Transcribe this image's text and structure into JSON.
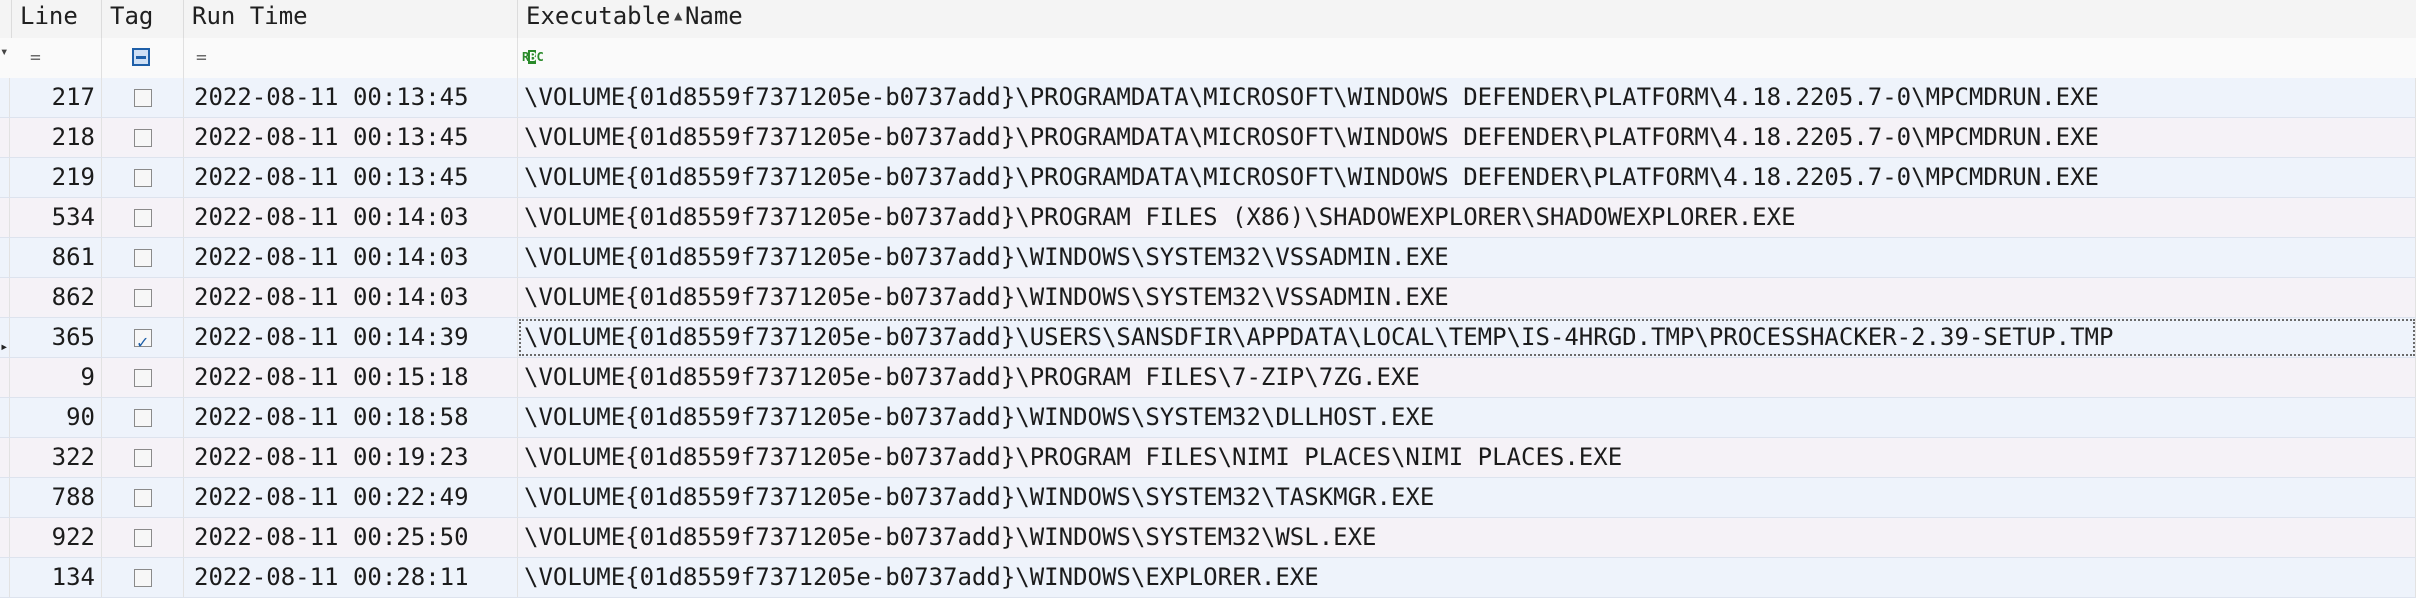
{
  "columns": {
    "line": "Line",
    "tag": "Tag",
    "run_time": "Run Time",
    "exe": "Executable Name"
  },
  "sort": {
    "column": "run_time",
    "direction": "ascending"
  },
  "filters": {
    "line_op": "=",
    "run_time_op": "="
  },
  "rows": [
    {
      "line": "217",
      "tagged": false,
      "run_time": "2022-08-11 00:13:45",
      "exe": "\\VOLUME{01d8559f7371205e-b0737add}\\PROGRAMDATA\\MICROSOFT\\WINDOWS DEFENDER\\PLATFORM\\4.18.2205.7-0\\MPCMDRUN.EXE"
    },
    {
      "line": "218",
      "tagged": false,
      "run_time": "2022-08-11 00:13:45",
      "exe": "\\VOLUME{01d8559f7371205e-b0737add}\\PROGRAMDATA\\MICROSOFT\\WINDOWS DEFENDER\\PLATFORM\\4.18.2205.7-0\\MPCMDRUN.EXE"
    },
    {
      "line": "219",
      "tagged": false,
      "run_time": "2022-08-11 00:13:45",
      "exe": "\\VOLUME{01d8559f7371205e-b0737add}\\PROGRAMDATA\\MICROSOFT\\WINDOWS DEFENDER\\PLATFORM\\4.18.2205.7-0\\MPCMDRUN.EXE"
    },
    {
      "line": "534",
      "tagged": false,
      "run_time": "2022-08-11 00:14:03",
      "exe": "\\VOLUME{01d8559f7371205e-b0737add}\\PROGRAM FILES (X86)\\SHADOWEXPLORER\\SHADOWEXPLORER.EXE"
    },
    {
      "line": "861",
      "tagged": false,
      "run_time": "2022-08-11 00:14:03",
      "exe": "\\VOLUME{01d8559f7371205e-b0737add}\\WINDOWS\\SYSTEM32\\VSSADMIN.EXE"
    },
    {
      "line": "862",
      "tagged": false,
      "run_time": "2022-08-11 00:14:03",
      "exe": "\\VOLUME{01d8559f7371205e-b0737add}\\WINDOWS\\SYSTEM32\\VSSADMIN.EXE"
    },
    {
      "line": "365",
      "tagged": true,
      "selected": true,
      "run_time": "2022-08-11 00:14:39",
      "exe": "\\VOLUME{01d8559f7371205e-b0737add}\\USERS\\SANSDFIR\\APPDATA\\LOCAL\\TEMP\\IS-4HRGD.TMP\\PROCESSHACKER-2.39-SETUP.TMP"
    },
    {
      "line": "9",
      "tagged": false,
      "run_time": "2022-08-11 00:15:18",
      "exe": "\\VOLUME{01d8559f7371205e-b0737add}\\PROGRAM FILES\\7-ZIP\\7ZG.EXE"
    },
    {
      "line": "90",
      "tagged": false,
      "run_time": "2022-08-11 00:18:58",
      "exe": "\\VOLUME{01d8559f7371205e-b0737add}\\WINDOWS\\SYSTEM32\\DLLHOST.EXE"
    },
    {
      "line": "322",
      "tagged": false,
      "run_time": "2022-08-11 00:19:23",
      "exe": "\\VOLUME{01d8559f7371205e-b0737add}\\PROGRAM FILES\\NIMI PLACES\\NIMI PLACES.EXE"
    },
    {
      "line": "788",
      "tagged": false,
      "run_time": "2022-08-11 00:22:49",
      "exe": "\\VOLUME{01d8559f7371205e-b0737add}\\WINDOWS\\SYSTEM32\\TASKMGR.EXE"
    },
    {
      "line": "922",
      "tagged": false,
      "run_time": "2022-08-11 00:25:50",
      "exe": "\\VOLUME{01d8559f7371205e-b0737add}\\WINDOWS\\SYSTEM32\\WSL.EXE"
    },
    {
      "line": "134",
      "tagged": false,
      "run_time": "2022-08-11 00:28:11",
      "exe": "\\VOLUME{01d8559f7371205e-b0737add}\\WINDOWS\\EXPLORER.EXE"
    }
  ]
}
